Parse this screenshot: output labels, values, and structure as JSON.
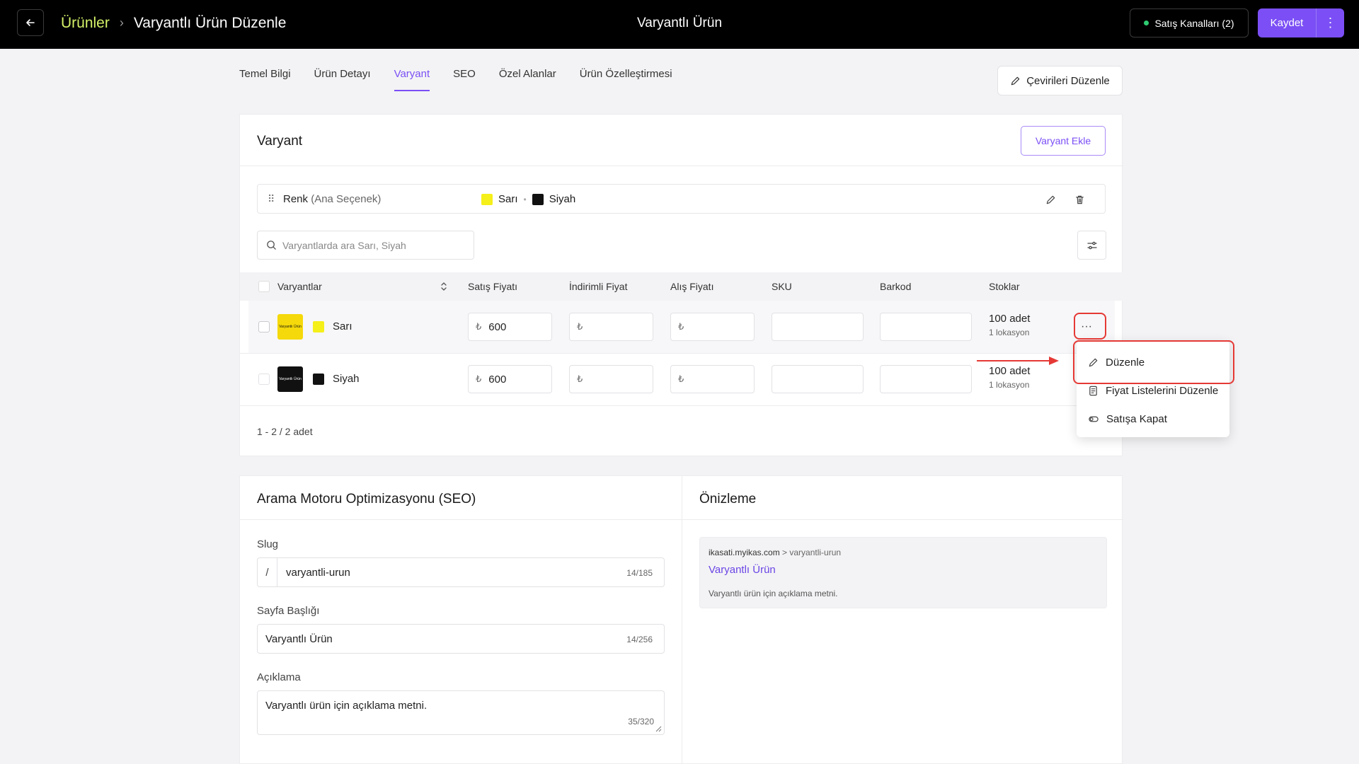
{
  "topbar": {
    "breadcrumb_root": "Ürünler",
    "breadcrumb_current": "Varyantlı Ürün Düzenle",
    "center_title": "Varyantlı Ürün",
    "channels_label": "Satış Kanalları (2)",
    "save_label": "Kaydet"
  },
  "tabs": [
    {
      "label": "Temel Bilgi"
    },
    {
      "label": "Ürün Detayı"
    },
    {
      "label": "Varyant",
      "active": true
    },
    {
      "label": "SEO"
    },
    {
      "label": "Özel Alanlar"
    },
    {
      "label": "Ürün Özelleştirmesi"
    }
  ],
  "translate_label": "Çevirileri Düzenle",
  "variant_section": {
    "title": "Varyant",
    "add_label": "Varyant Ekle",
    "option": {
      "name": "Renk",
      "qualifier": "(Ana Seçenek)",
      "values": [
        {
          "label": "Sarı",
          "color": "#f5ef1a"
        },
        {
          "label": "Siyah",
          "color": "#111111"
        }
      ]
    },
    "search_placeholder": "Varyantlarda ara Sarı, Siyah",
    "columns": [
      "Varyantlar",
      "Satış Fiyatı",
      "İndirimli Fiyat",
      "Alış Fiyatı",
      "SKU",
      "Barkod",
      "Stoklar"
    ],
    "currency_symbol": "₺",
    "rows": [
      {
        "name": "Sarı",
        "swatch": "#f5ef1a",
        "thumb_bg": "#f5d90a",
        "thumb_fg": "#111111",
        "thumb_text": "Varyantlı Ürün",
        "sale_price": "600",
        "discount_price": "",
        "buy_price": "",
        "sku": "",
        "barcode": "",
        "stock": "100 adet",
        "locations": "1 lokasyon"
      },
      {
        "name": "Siyah",
        "swatch": "#111111",
        "thumb_bg": "#111111",
        "thumb_fg": "#ffffff",
        "thumb_text": "Varyantlı Ürün",
        "sale_price": "600",
        "discount_price": "",
        "buy_price": "",
        "sku": "",
        "barcode": "",
        "stock": "100 adet",
        "locations": "1 lokasyon"
      }
    ],
    "pagination": "1 - 2 / 2 adet"
  },
  "row_menu": {
    "items": [
      {
        "label": "Düzenle",
        "icon": "pencil-icon"
      },
      {
        "label": "Fiyat Listelerini Düzenle",
        "icon": "price-list-icon"
      },
      {
        "label": "Satışa Kapat",
        "icon": "toggle-icon"
      }
    ]
  },
  "seo": {
    "title": "Arama Motoru Optimizasyonu (SEO)",
    "slug_label": "Slug",
    "slug_prefix": "/",
    "slug_value": "varyantli-urun",
    "slug_count": "14/185",
    "page_title_label": "Sayfa Başlığı",
    "page_title_value": "Varyantlı Ürün",
    "page_title_count": "14/256",
    "description_label": "Açıklama",
    "description_value": "Varyantlı ürün için açıklama metni.",
    "description_count": "35/320"
  },
  "preview": {
    "title": "Önizleme",
    "domain": "ikasati.myikas.com",
    "path": "> varyantli-urun",
    "page_title": "Varyantlı Ürün",
    "description": "Varyantlı ürün için açıklama metni."
  },
  "colors": {
    "accent": "#7b4ff5",
    "breadcrumb_root": "#d4f268",
    "highlight": "#e53935"
  }
}
